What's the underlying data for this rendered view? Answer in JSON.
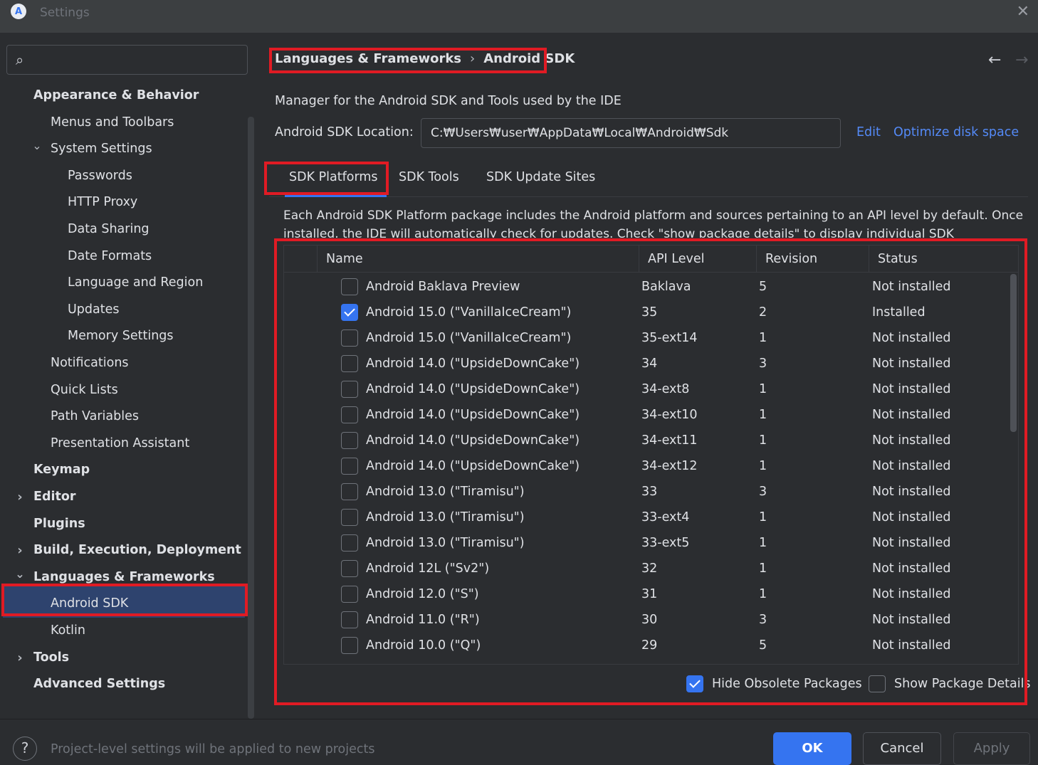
{
  "window": {
    "title": "Settings"
  },
  "search": {
    "placeholder": ""
  },
  "sidebar": {
    "items": [
      {
        "label": "Appearance & Behavior",
        "indent": 0,
        "bold": true,
        "expand": ""
      },
      {
        "label": "Menus and Toolbars",
        "indent": 1,
        "bold": false,
        "expand": ""
      },
      {
        "label": "System Settings",
        "indent": 1,
        "bold": false,
        "expand": "expanded"
      },
      {
        "label": "Passwords",
        "indent": 2,
        "bold": false,
        "expand": ""
      },
      {
        "label": "HTTP Proxy",
        "indent": 2,
        "bold": false,
        "expand": ""
      },
      {
        "label": "Data Sharing",
        "indent": 2,
        "bold": false,
        "expand": ""
      },
      {
        "label": "Date Formats",
        "indent": 2,
        "bold": false,
        "expand": ""
      },
      {
        "label": "Language and Region",
        "indent": 2,
        "bold": false,
        "expand": ""
      },
      {
        "label": "Updates",
        "indent": 2,
        "bold": false,
        "expand": ""
      },
      {
        "label": "Memory Settings",
        "indent": 2,
        "bold": false,
        "expand": ""
      },
      {
        "label": "Notifications",
        "indent": 1,
        "bold": false,
        "expand": ""
      },
      {
        "label": "Quick Lists",
        "indent": 1,
        "bold": false,
        "expand": ""
      },
      {
        "label": "Path Variables",
        "indent": 1,
        "bold": false,
        "expand": ""
      },
      {
        "label": "Presentation Assistant",
        "indent": 1,
        "bold": false,
        "expand": ""
      },
      {
        "label": "Keymap",
        "indent": 0,
        "bold": true,
        "expand": ""
      },
      {
        "label": "Editor",
        "indent": 0,
        "bold": true,
        "expand": "collapsed"
      },
      {
        "label": "Plugins",
        "indent": 0,
        "bold": true,
        "expand": ""
      },
      {
        "label": "Build, Execution, Deployment",
        "indent": 0,
        "bold": true,
        "expand": "collapsed"
      },
      {
        "label": "Languages & Frameworks",
        "indent": 0,
        "bold": true,
        "expand": "expanded"
      },
      {
        "label": "Android SDK",
        "indent": 1,
        "bold": false,
        "expand": "",
        "selected": true
      },
      {
        "label": "Kotlin",
        "indent": 1,
        "bold": false,
        "expand": ""
      },
      {
        "label": "Tools",
        "indent": 0,
        "bold": true,
        "expand": "collapsed"
      },
      {
        "label": "Advanced Settings",
        "indent": 0,
        "bold": true,
        "expand": ""
      }
    ]
  },
  "breadcrumb": {
    "parent": "Languages & Frameworks",
    "separator": "›",
    "current": "Android SDK"
  },
  "nav": {
    "back": "←",
    "forward": "→"
  },
  "main": {
    "description": "Manager for the Android SDK and Tools used by the IDE",
    "location_label": "Android SDK Location:",
    "location_value": "C:₩Users₩user₩AppData₩Local₩Android₩Sdk",
    "edit_link": "Edit",
    "optimize_link": "Optimize disk space",
    "tabs": [
      {
        "label": "SDK Platforms",
        "active": true
      },
      {
        "label": "SDK Tools",
        "active": false
      },
      {
        "label": "SDK Update Sites",
        "active": false
      }
    ],
    "info": "Each Android SDK Platform package includes the Android platform and sources pertaining to an API level by default. Once installed, the IDE will automatically check for updates. Check \"show package details\" to display individual SDK components."
  },
  "table": {
    "columns": [
      "Name",
      "API Level",
      "Revision",
      "Status"
    ],
    "rows": [
      {
        "checked": false,
        "name": "Android Baklava Preview",
        "api": "Baklava",
        "revision": "5",
        "status": "Not installed"
      },
      {
        "checked": true,
        "name": "Android 15.0 (\"VanillaIceCream\")",
        "api": "35",
        "revision": "2",
        "status": "Installed"
      },
      {
        "checked": false,
        "name": "Android 15.0 (\"VanillaIceCream\")",
        "api": "35-ext14",
        "revision": "1",
        "status": "Not installed"
      },
      {
        "checked": false,
        "name": "Android 14.0 (\"UpsideDownCake\")",
        "api": "34",
        "revision": "3",
        "status": "Not installed"
      },
      {
        "checked": false,
        "name": "Android 14.0 (\"UpsideDownCake\")",
        "api": "34-ext8",
        "revision": "1",
        "status": "Not installed"
      },
      {
        "checked": false,
        "name": "Android 14.0 (\"UpsideDownCake\")",
        "api": "34-ext10",
        "revision": "1",
        "status": "Not installed"
      },
      {
        "checked": false,
        "name": "Android 14.0 (\"UpsideDownCake\")",
        "api": "34-ext11",
        "revision": "1",
        "status": "Not installed"
      },
      {
        "checked": false,
        "name": "Android 14.0 (\"UpsideDownCake\")",
        "api": "34-ext12",
        "revision": "1",
        "status": "Not installed"
      },
      {
        "checked": false,
        "name": "Android 13.0 (\"Tiramisu\")",
        "api": "33",
        "revision": "3",
        "status": "Not installed"
      },
      {
        "checked": false,
        "name": "Android 13.0 (\"Tiramisu\")",
        "api": "33-ext4",
        "revision": "1",
        "status": "Not installed"
      },
      {
        "checked": false,
        "name": "Android 13.0 (\"Tiramisu\")",
        "api": "33-ext5",
        "revision": "1",
        "status": "Not installed"
      },
      {
        "checked": false,
        "name": "Android 12L (\"Sv2\")",
        "api": "32",
        "revision": "1",
        "status": "Not installed"
      },
      {
        "checked": false,
        "name": "Android 12.0 (\"S\")",
        "api": "31",
        "revision": "1",
        "status": "Not installed"
      },
      {
        "checked": false,
        "name": "Android 11.0 (\"R\")",
        "api": "30",
        "revision": "3",
        "status": "Not installed"
      },
      {
        "checked": false,
        "name": "Android 10.0 (\"Q\")",
        "api": "29",
        "revision": "5",
        "status": "Not installed"
      }
    ]
  },
  "options": {
    "hide_obsolete": {
      "label": "Hide Obsolete Packages",
      "checked": true
    },
    "show_details": {
      "label": "Show Package Details",
      "checked": false
    }
  },
  "footer": {
    "help": "?",
    "note": "Project-level settings will be applied to new projects",
    "ok": "OK",
    "cancel": "Cancel",
    "apply": "Apply"
  },
  "colors": {
    "accent": "#3574f0",
    "link": "#548af7",
    "highlight_outline": "#e01b24",
    "selection": "#2e436e",
    "background": "#2b2d30"
  }
}
